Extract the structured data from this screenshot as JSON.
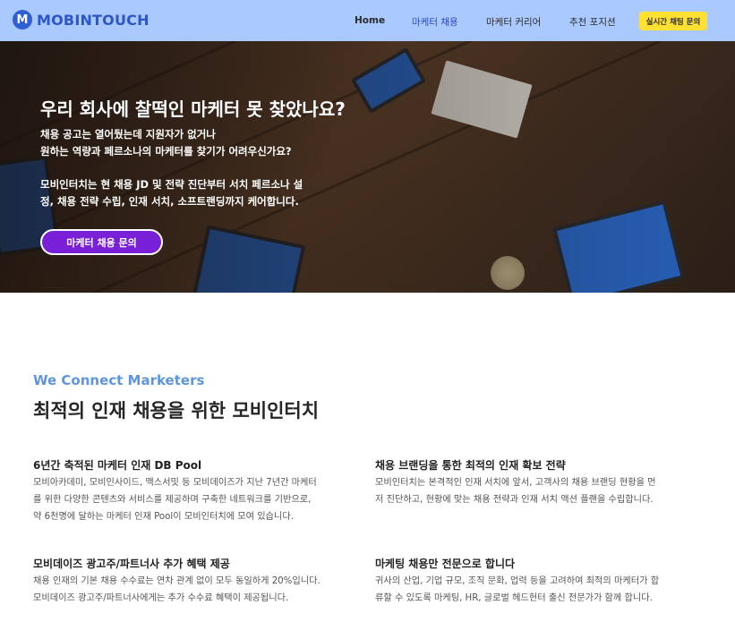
{
  "header": {
    "logo_letter": "M",
    "logo_text": "MOBINTOUCH",
    "nav": [
      "Home",
      "마케터 채용",
      "마케터 커리어",
      "추천 포지션"
    ],
    "cta": "실시간 채팅 문의",
    "colors": {
      "bar": "#a9c9ff",
      "cta": "#ffe033",
      "logo": "#2d56c7"
    }
  },
  "hero": {
    "title": "우리 회사에 찰떡인 마케터 못 찾았나요?",
    "sub1": "채용 공고는 열어뒀는데 지원자가 없거나",
    "sub2": "원하는 역량과 페르소나의 마케터를 찾기가 어려우신가요?",
    "sub3": "모비인터치는 현 채용 JD 및 전략 진단부터 서치 페르소나 설",
    "sub4": "정, 채용 전략 수립, 인재 서치, 소프트랜딩까지 케어합니다.",
    "button": "마케터 채용 문의",
    "button_color": "#7a1fd8"
  },
  "intro": {
    "kicker": "We Connect Marketers",
    "headline": "최적의 인재 채용을 위한 모비인터치"
  },
  "features": [
    {
      "title": "6년간 축적된 마케터 인재 DB Pool",
      "lines": [
        "모비아카데미, 모비인사이드, 맥스서밋 등 모비데이즈가 지난 7년간 마케터",
        "를 위한 다양한 콘텐츠와 서비스를 제공하며 구축한 네트워크를 기반으로,",
        "약 6천명에 달하는 마케터 인재 Pool이 모비인터치에 모여 있습니다."
      ]
    },
    {
      "title": "채용 브랜딩을 통한 최적의 인재 확보 전략",
      "lines": [
        "모비인터치는 본격적인 인재 서치에 앞서, 고객사의 채용 브랜딩 현황을 먼",
        "저 진단하고, 현황에 맞는 채용 전략과 인재 서치 액션 플랜을 수립합니다."
      ]
    },
    {
      "title": "모비데이즈 광고주/파트너사 추가 혜택 제공",
      "lines": [
        "채용 인재의 기본 채용 수수료는 연차 관계 없이 모두 동일하게 20%입니다.",
        "모비데이즈 광고주/파트너사에게는 추가 수수료 혜택이 제공됩니다."
      ]
    },
    {
      "title": "마케팅 채용만 전문으로 합니다",
      "lines": [
        "귀사의 산업, 기업 규모, 조직 문화, 업력 등을 고려하여 최적의 마케터가 합",
        "류할 수 있도록 마케팅, HR, 글로벌 헤드헌터 출신 전문가가 함께 합니다."
      ]
    }
  ]
}
